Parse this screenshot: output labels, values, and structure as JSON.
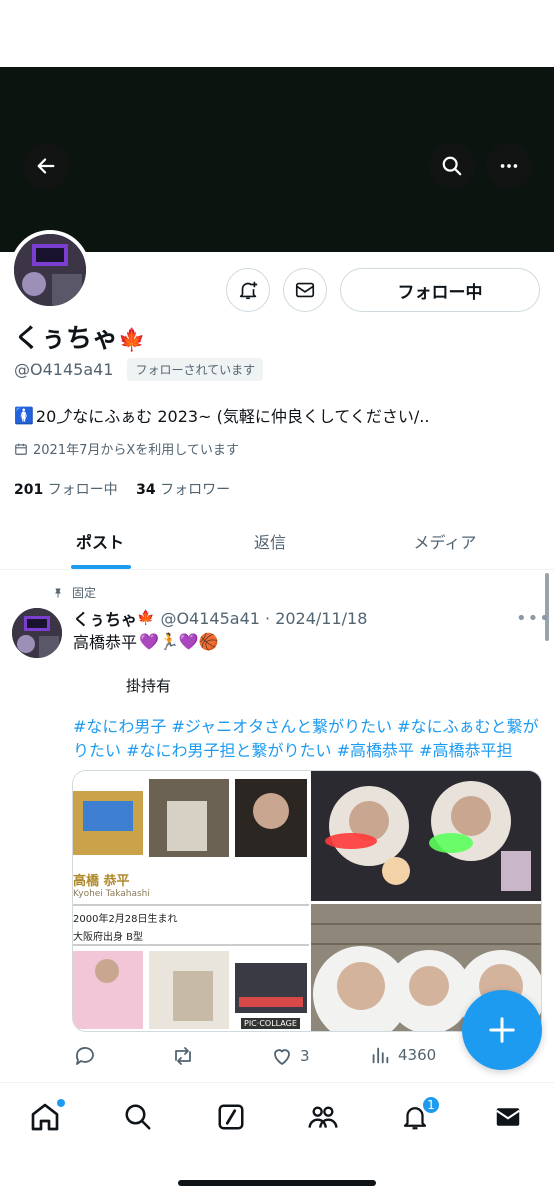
{
  "header": {
    "back_icon": "arrow-left-icon",
    "search_icon": "search-icon",
    "more_icon": "more-icon"
  },
  "profile": {
    "display_name": "くぅちゃ",
    "name_emoji": "🍁",
    "handle": "@O4145a41",
    "follows_you": "フォローされています",
    "bio_emoji": "🚺",
    "bio": "20⤴なにふぁむ 2023~ (気軽に仲良くしてください/..",
    "joined": "2021年7月からXを利用しています",
    "following_count": "201",
    "following_label": "フォロー中",
    "followers_count": "34",
    "followers_label": "フォロワー"
  },
  "buttons": {
    "follow": "フォロー中",
    "notify_icon": "bell-plus-icon",
    "message_icon": "envelope-icon"
  },
  "tabs": [
    {
      "label": "ポスト",
      "active": true
    },
    {
      "label": "返信",
      "active": false
    },
    {
      "label": "メディア",
      "active": false
    }
  ],
  "post": {
    "pinned_label": "固定",
    "author": "くぅちゃ",
    "author_emoji": "🍁",
    "meta": "@O4145a41 · 2024/11/18",
    "line1": "高橋恭平",
    "line1_emoji": "💜🏃💜🏀",
    "line2": "掛持有",
    "hashtags": "#なにわ男子 #ジャニオタさんと繋がりたい #なにふぁむと繋がりたい #なにわ男子担と繋がりたい #高橋恭平 #高橋恭平担",
    "media": {
      "left_name": "高橋 恭平",
      "left_romaji": "Kyohei Takahashi",
      "left_birth": "2000年2月28日生まれ",
      "left_origin": "大阪府出身 B型",
      "left_watermark": "PIC·COLLAGE"
    },
    "likes": "3",
    "views": "4360"
  },
  "nav": {
    "notifications_badge": "1"
  },
  "colors": {
    "accent": "#1d9bf0",
    "banner": "#0b140f",
    "text": "#0f1419",
    "muted": "#536471"
  }
}
